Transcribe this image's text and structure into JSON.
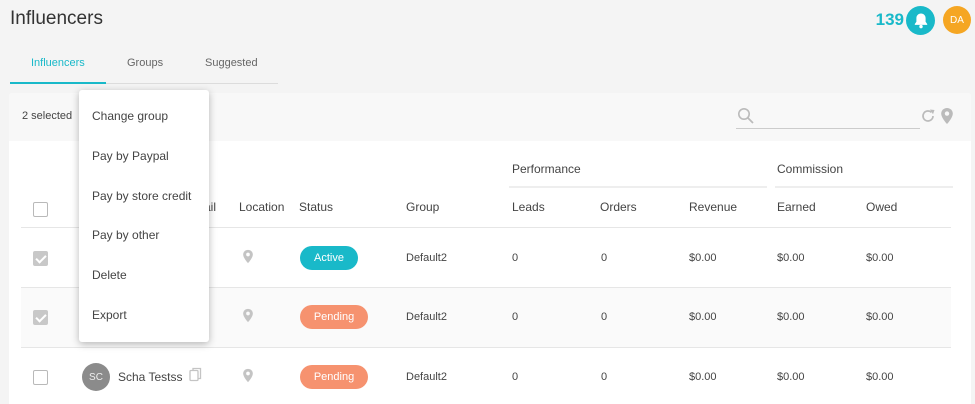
{
  "page": {
    "title": "Influencers"
  },
  "top_bar": {
    "notification_count": "139",
    "avatar_initials": "DA"
  },
  "tabs": [
    {
      "label": "Influencers",
      "active": true
    },
    {
      "label": "Groups",
      "active": false
    },
    {
      "label": "Suggested",
      "active": false
    }
  ],
  "toolbar": {
    "selected_text": "2 selected",
    "search_placeholder": "",
    "search_value": ""
  },
  "table": {
    "group_headers": {
      "performance": "Performance",
      "commission": "Commission"
    },
    "columns": {
      "email_fragment": "ail",
      "location": "Location",
      "status": "Status",
      "group": "Group",
      "leads": "Leads",
      "orders": "Orders",
      "revenue": "Revenue",
      "earned": "Earned",
      "owed": "Owed"
    },
    "rows": [
      {
        "checked": true,
        "status": "Active",
        "status_type": "active",
        "group": "Default2",
        "leads": "0",
        "orders": "0",
        "revenue": "$0.00",
        "earned": "$0.00",
        "owed": "$0.00"
      },
      {
        "checked": true,
        "status": "Pending",
        "status_type": "pending",
        "group": "Default2",
        "leads": "0",
        "orders": "0",
        "revenue": "$0.00",
        "earned": "$0.00",
        "owed": "$0.00"
      },
      {
        "checked": false,
        "initials": "SC",
        "name": "Scha Testss",
        "status": "Pending",
        "status_type": "pending",
        "group": "Default2",
        "leads": "0",
        "orders": "0",
        "revenue": "$0.00",
        "earned": "$0.00",
        "owed": "$0.00"
      }
    ]
  },
  "bulk_menu": {
    "items": [
      "Change group",
      "Pay by Paypal",
      "Pay by store credit",
      "Pay by other",
      "Delete",
      "Export"
    ]
  },
  "colors": {
    "accent": "#19b9c9",
    "avatar": "#f5a623",
    "pending": "#f6926f",
    "active": "#19b9c9"
  },
  "icons": [
    "bell-icon",
    "search-icon",
    "refresh-icon",
    "location-pin-icon",
    "copy-icon"
  ]
}
